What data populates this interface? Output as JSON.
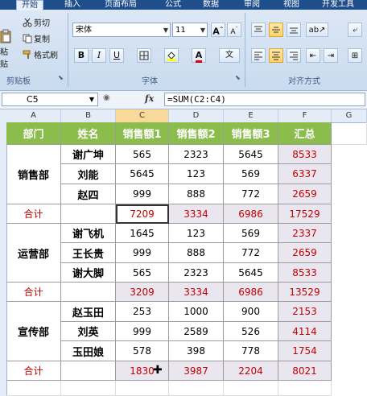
{
  "ribbon": {
    "tabs": [
      "开始",
      "插入",
      "页面布局",
      "公式",
      "数据",
      "审阅",
      "视图",
      "开发工具"
    ],
    "clipboard": {
      "paste": "粘贴",
      "cut": "剪切",
      "copy": "复制",
      "format_painter": "格式刷",
      "group": "剪贴板"
    },
    "font": {
      "name": "宋体",
      "size": "11",
      "group": "字体",
      "wen": "文"
    },
    "alignment": {
      "group": "对齐方式"
    }
  },
  "formula_bar": {
    "name_box": "C5",
    "fx": "fx",
    "formula": "=SUM(C2:C4)"
  },
  "columns": [
    "A",
    "B",
    "C",
    "D",
    "E",
    "F",
    "G"
  ],
  "table": {
    "headers": [
      "部门",
      "姓名",
      "销售额1",
      "销售额2",
      "销售额3",
      "汇总"
    ],
    "groups": [
      {
        "dept": "销售部",
        "rows": [
          {
            "name": "谢广坤",
            "s1": "565",
            "s2": "2323",
            "s3": "5645",
            "total": "8533"
          },
          {
            "name": "刘能",
            "s1": "5645",
            "s2": "123",
            "s3": "569",
            "total": "6337"
          },
          {
            "name": "赵四",
            "s1": "999",
            "s2": "888",
            "s3": "772",
            "total": "2659"
          }
        ],
        "subtotal": {
          "label": "合计",
          "s1": "7209",
          "s2": "3334",
          "s3": "6986",
          "total": "17529"
        }
      },
      {
        "dept": "运营部",
        "rows": [
          {
            "name": "谢飞机",
            "s1": "1645",
            "s2": "123",
            "s3": "569",
            "total": "2337"
          },
          {
            "name": "王长贵",
            "s1": "999",
            "s2": "888",
            "s3": "772",
            "total": "2659"
          },
          {
            "name": "谢大脚",
            "s1": "565",
            "s2": "2323",
            "s3": "5645",
            "total": "8533"
          }
        ],
        "subtotal": {
          "label": "合计",
          "s1": "3209",
          "s2": "3334",
          "s3": "6986",
          "total": "13529"
        }
      },
      {
        "dept": "宣传部",
        "rows": [
          {
            "name": "赵玉田",
            "s1": "253",
            "s2": "1000",
            "s3": "900",
            "total": "2153"
          },
          {
            "name": "刘英",
            "s1": "999",
            "s2": "2589",
            "s3": "526",
            "total": "4114"
          },
          {
            "name": "玉田娘",
            "s1": "578",
            "s2": "398",
            "s3": "778",
            "total": "1754"
          }
        ],
        "subtotal": {
          "label": "合计",
          "s1": "1830",
          "s2": "3987",
          "s3": "2204",
          "total": "8021"
        }
      }
    ]
  }
}
